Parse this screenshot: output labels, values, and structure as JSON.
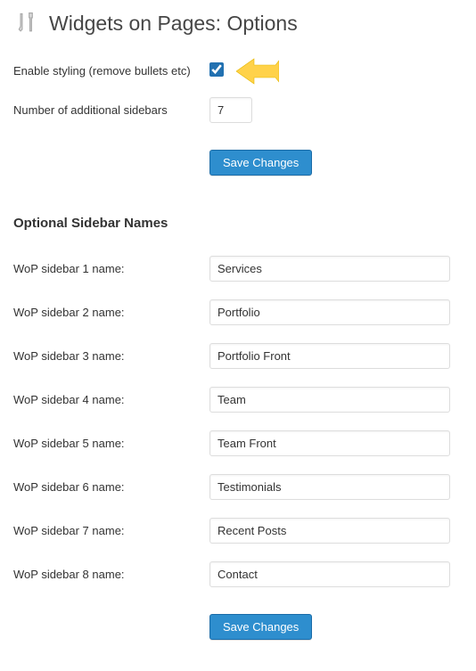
{
  "header": {
    "title": "Widgets on Pages: Options"
  },
  "options": {
    "enable_styling_label": "Enable styling (remove bullets etc)",
    "enable_styling_checked": true,
    "num_sidebars_label": "Number of additional sidebars",
    "num_sidebars_value": "7"
  },
  "save_button_label": "Save Changes",
  "section_title": "Optional Sidebar Names",
  "sidebars": [
    {
      "label": "WoP sidebar 1 name:",
      "value": "Services"
    },
    {
      "label": "WoP sidebar 2 name:",
      "value": "Portfolio"
    },
    {
      "label": "WoP sidebar 3 name:",
      "value": "Portfolio Front"
    },
    {
      "label": "WoP sidebar 4 name:",
      "value": "Team"
    },
    {
      "label": "WoP sidebar 5 name:",
      "value": "Team Front"
    },
    {
      "label": "WoP sidebar 6 name:",
      "value": "Testimonials"
    },
    {
      "label": "WoP sidebar 7 name:",
      "value": "Recent Posts"
    },
    {
      "label": "WoP sidebar 8 name:",
      "value": "Contact"
    }
  ]
}
